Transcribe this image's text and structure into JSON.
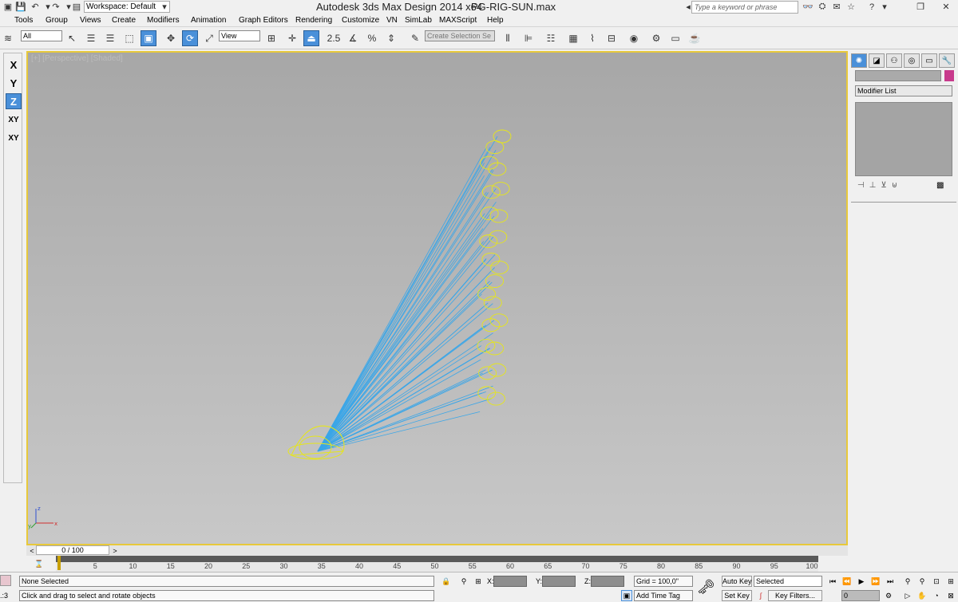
{
  "window": {
    "title": "Autodesk 3ds Max Design 2014 x64",
    "file": "PG-RIG-SUN.max",
    "workspace": "Workspace: Default",
    "search_placeholder": "Type a keyword or phrase"
  },
  "menu": [
    "Tools",
    "Group",
    "Views",
    "Create",
    "Modifiers",
    "Animation",
    "Graph Editors",
    "Rendering",
    "Customize",
    "VN",
    "SimLab",
    "MAXScript",
    "Help"
  ],
  "toolbar": {
    "selection_filter": "All",
    "reference_coord": "View",
    "snap_value": "2.5",
    "named_selection_placeholder": "Create Selection Se"
  },
  "axis_constraints": [
    "X",
    "Y",
    "Z",
    "XY",
    "XY"
  ],
  "viewport": {
    "label": "[+] [Perspective] [Shaded]"
  },
  "command_panel": {
    "modifier_list": "Modifier List"
  },
  "timeline": {
    "frame": "0 / 100",
    "ticks": [
      "5",
      "10",
      "15",
      "20",
      "25",
      "30",
      "35",
      "40",
      "45",
      "50",
      "55",
      "60",
      "65",
      "70",
      "75",
      "80",
      "85",
      "90",
      "95",
      "100"
    ]
  },
  "status": {
    "selection": "None Selected",
    "prompt": "Click and drag to select and rotate objects",
    "x_label": "X:",
    "y_label": "Y:",
    "z_label": "Z:",
    "grid": "Grid = 100,0\"",
    "add_time_tag": "Add Time Tag",
    "auto_key": "Auto Key",
    "set_key": "Set Key",
    "key_mode": "Selected",
    "key_filters": "Key Filters...",
    "current_frame": "0"
  }
}
